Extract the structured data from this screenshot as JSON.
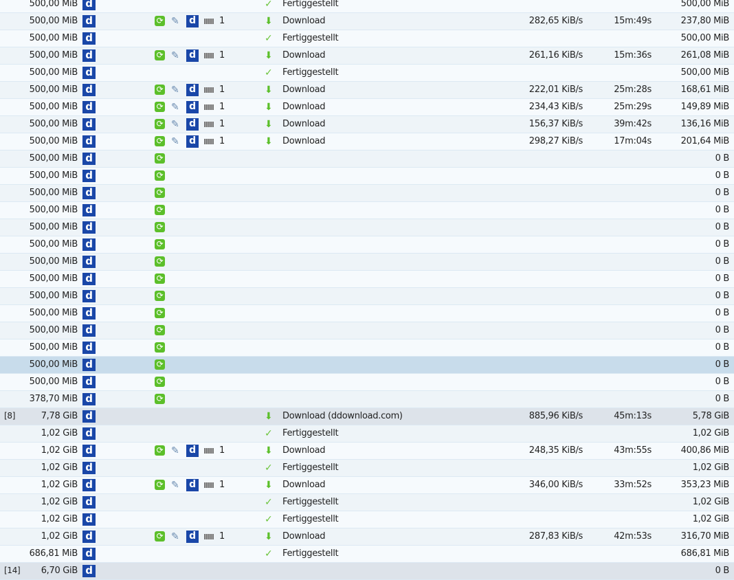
{
  "colors": {
    "hoster": "#1a47a8",
    "green": "#5cbf2a",
    "selected": "#c8dceb",
    "package": "#dde3ea"
  },
  "rows": [
    {
      "size": "500,00 MiB",
      "status": "Fertiggestellt",
      "loaded": "500,00 MiB",
      "state": "done"
    },
    {
      "size": "500,00 MiB",
      "status": "Download",
      "speed": "282,65 KiB/s",
      "eta": "15m:49s",
      "loaded": "237,80 MiB",
      "state": "dl",
      "conn": "1"
    },
    {
      "size": "500,00 MiB",
      "status": "Fertiggestellt",
      "loaded": "500,00 MiB",
      "state": "done"
    },
    {
      "size": "500,00 MiB",
      "status": "Download",
      "speed": "261,16 KiB/s",
      "eta": "15m:36s",
      "loaded": "261,08 MiB",
      "state": "dl",
      "conn": "1"
    },
    {
      "size": "500,00 MiB",
      "status": "Fertiggestellt",
      "loaded": "500,00 MiB",
      "state": "done"
    },
    {
      "size": "500,00 MiB",
      "status": "Download",
      "speed": "222,01 KiB/s",
      "eta": "25m:28s",
      "loaded": "168,61 MiB",
      "state": "dl",
      "conn": "1"
    },
    {
      "size": "500,00 MiB",
      "status": "Download",
      "speed": "234,43 KiB/s",
      "eta": "25m:29s",
      "loaded": "149,89 MiB",
      "state": "dl",
      "conn": "1"
    },
    {
      "size": "500,00 MiB",
      "status": "Download",
      "speed": "156,37 KiB/s",
      "eta": "39m:42s",
      "loaded": "136,16 MiB",
      "state": "dl",
      "conn": "1"
    },
    {
      "size": "500,00 MiB",
      "status": "Download",
      "speed": "298,27 KiB/s",
      "eta": "17m:04s",
      "loaded": "201,64 MiB",
      "state": "dl",
      "conn": "1"
    },
    {
      "size": "500,00 MiB",
      "loaded": "0 B",
      "state": "wait"
    },
    {
      "size": "500,00 MiB",
      "loaded": "0 B",
      "state": "wait"
    },
    {
      "size": "500,00 MiB",
      "loaded": "0 B",
      "state": "wait"
    },
    {
      "size": "500,00 MiB",
      "loaded": "0 B",
      "state": "wait"
    },
    {
      "size": "500,00 MiB",
      "loaded": "0 B",
      "state": "wait"
    },
    {
      "size": "500,00 MiB",
      "loaded": "0 B",
      "state": "wait"
    },
    {
      "size": "500,00 MiB",
      "loaded": "0 B",
      "state": "wait"
    },
    {
      "size": "500,00 MiB",
      "loaded": "0 B",
      "state": "wait"
    },
    {
      "size": "500,00 MiB",
      "loaded": "0 B",
      "state": "wait"
    },
    {
      "size": "500,00 MiB",
      "loaded": "0 B",
      "state": "wait"
    },
    {
      "size": "500,00 MiB",
      "loaded": "0 B",
      "state": "wait"
    },
    {
      "size": "500,00 MiB",
      "loaded": "0 B",
      "state": "wait"
    },
    {
      "size": "500,00 MiB",
      "loaded": "0 B",
      "state": "wait",
      "selected": true
    },
    {
      "size": "500,00 MiB",
      "loaded": "0 B",
      "state": "wait"
    },
    {
      "size": "378,70 MiB",
      "loaded": "0 B",
      "state": "wait"
    },
    {
      "package": true,
      "mark": "[8]",
      "size": "7,78 GiB",
      "status": "Download (ddownload.com)",
      "speed": "885,96 KiB/s",
      "eta": "45m:13s",
      "loaded": "5,78 GiB",
      "state": "pkgdl"
    },
    {
      "size": "1,02 GiB",
      "status": "Fertiggestellt",
      "loaded": "1,02 GiB",
      "state": "done"
    },
    {
      "size": "1,02 GiB",
      "status": "Download",
      "speed": "248,35 KiB/s",
      "eta": "43m:55s",
      "loaded": "400,86 MiB",
      "state": "dl",
      "conn": "1"
    },
    {
      "size": "1,02 GiB",
      "status": "Fertiggestellt",
      "loaded": "1,02 GiB",
      "state": "done"
    },
    {
      "size": "1,02 GiB",
      "status": "Download",
      "speed": "346,00 KiB/s",
      "eta": "33m:52s",
      "loaded": "353,23 MiB",
      "state": "dl",
      "conn": "1"
    },
    {
      "size": "1,02 GiB",
      "status": "Fertiggestellt",
      "loaded": "1,02 GiB",
      "state": "done"
    },
    {
      "size": "1,02 GiB",
      "status": "Fertiggestellt",
      "loaded": "1,02 GiB",
      "state": "done"
    },
    {
      "size": "1,02 GiB",
      "status": "Download",
      "speed": "287,83 KiB/s",
      "eta": "42m:53s",
      "loaded": "316,70 MiB",
      "state": "dl",
      "conn": "1"
    },
    {
      "size": "686,81 MiB",
      "status": "Fertiggestellt",
      "loaded": "686,81 MiB",
      "state": "done"
    },
    {
      "package": true,
      "mark": "[14]",
      "size": "6,70 GiB",
      "loaded": "0 B",
      "state": "pkg"
    }
  ]
}
